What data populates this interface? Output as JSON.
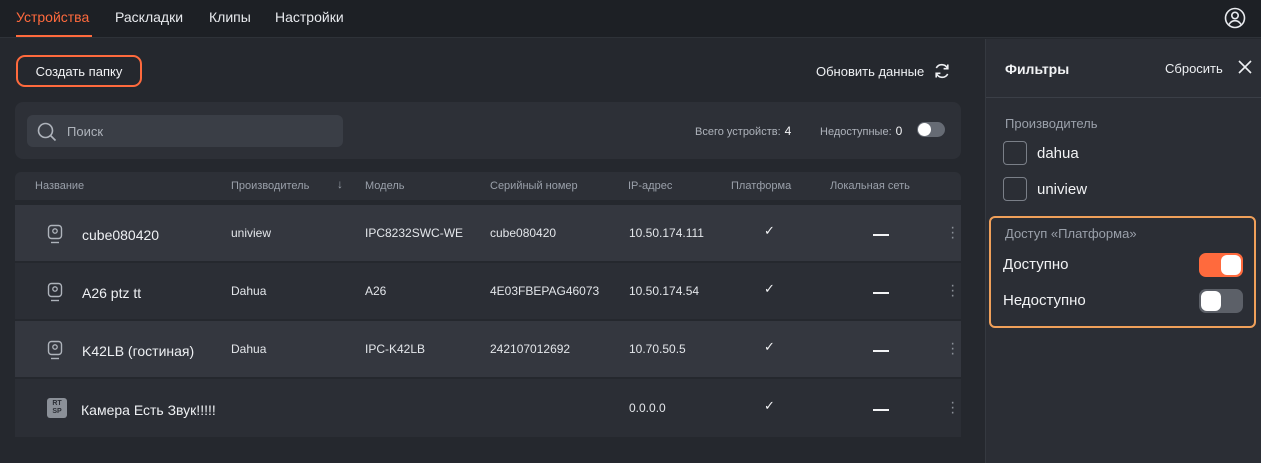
{
  "nav": {
    "tabs": [
      {
        "label": "Устройства",
        "active": true
      },
      {
        "label": "Раскладки",
        "active": false
      },
      {
        "label": "Клипы",
        "active": false
      },
      {
        "label": "Настройки",
        "active": false
      }
    ],
    "user_icon": "user-circle-icon"
  },
  "toolbar": {
    "create_folder_label": "Создать папку",
    "refresh_label": "Обновить данные"
  },
  "search": {
    "placeholder": "Поиск",
    "value": ""
  },
  "stats": {
    "total_label": "Всего устройств:",
    "total_value": "4",
    "unavailable_label": "Недоступные:",
    "unavailable_value": "0",
    "unavailable_toggle_on": false
  },
  "table": {
    "columns": [
      "Название",
      "Производитель",
      "Модель",
      "Серийный номер",
      "IP-адрес",
      "Платформа",
      "Локальная сеть"
    ],
    "sort_column": "Производитель",
    "rows": [
      {
        "icon": "camera-icon",
        "name": "cube080420",
        "manufacturer": "uniview",
        "model": "IPC8232SWC-WE",
        "serial": "cube080420",
        "ip": "10.50.174.111",
        "platform": true,
        "local": "—"
      },
      {
        "icon": "camera-icon",
        "name": "A26 ptz tt",
        "manufacturer": "Dahua",
        "model": "A26",
        "serial": "4E03FBEPAG46073",
        "ip": "10.50.174.54",
        "platform": true,
        "local": "—"
      },
      {
        "icon": "camera-icon",
        "name": "K42LB (гостиная)",
        "manufacturer": "Dahua",
        "model": "IPC-K42LB",
        "serial": "242107012692",
        "ip": "10.70.50.5",
        "platform": true,
        "local": "—"
      },
      {
        "icon": "rtsp-icon",
        "icon_text": "RT SP",
        "name": "Камера Есть Звук!!!!!",
        "manufacturer": "",
        "model": "",
        "serial": "",
        "ip": "0.0.0.0",
        "platform": true,
        "local": "—"
      }
    ]
  },
  "filters": {
    "title": "Фильтры",
    "reset_label": "Сбросить",
    "manufacturer_section": "Производитель",
    "manufacturers": [
      {
        "label": "dahua",
        "checked": false
      },
      {
        "label": "uniview",
        "checked": false
      }
    ],
    "access_section": "Доступ «Платформа»",
    "access_options": [
      {
        "label": "Доступно",
        "on": true
      },
      {
        "label": "Недоступно",
        "on": false
      }
    ]
  },
  "colors": {
    "accent": "#ff6a3d",
    "highlight_border": "#f0a05a",
    "background": "#25282e"
  }
}
